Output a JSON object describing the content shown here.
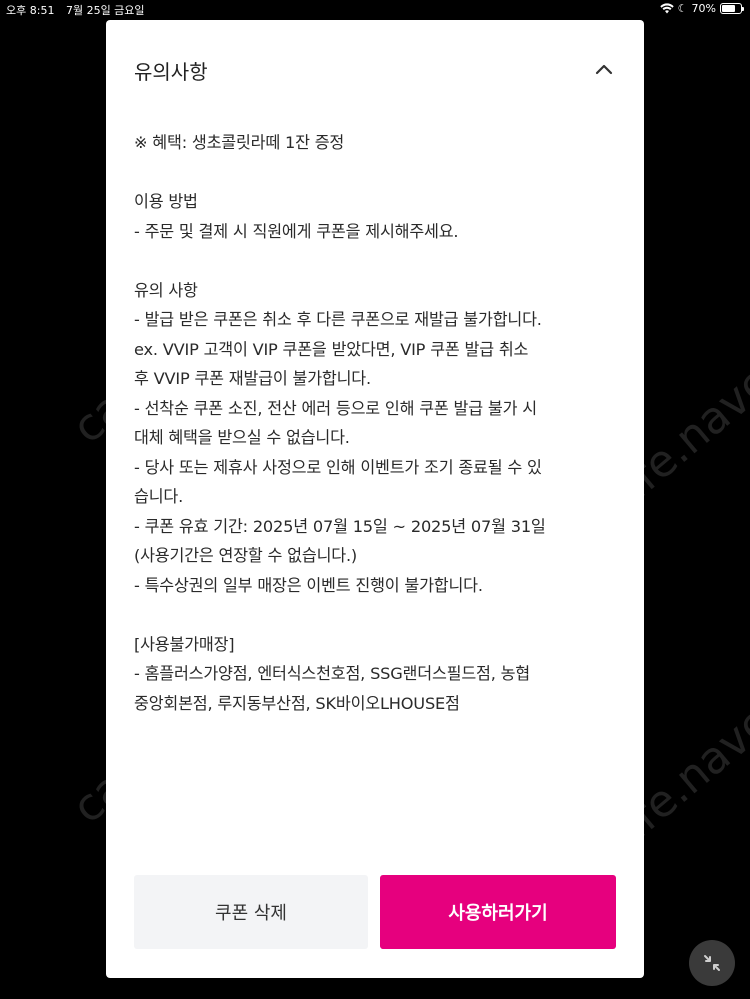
{
  "status_bar": {
    "time": "오후 8:51",
    "date": "7월 25일 금요일",
    "battery": "70%",
    "battery_level": 0.7,
    "icons": [
      "wifi-icon",
      "moon-icon",
      "battery-icon"
    ]
  },
  "watermark": {
    "text": "cafe.naver.com"
  },
  "panel": {
    "title": "유의사항",
    "collapse_icon": "chevron-up-icon",
    "lines": [
      "※ 혜택: 생초콜릿라떼 1잔 증정",
      "",
      "이용 방법",
      "- 주문 및 결제 시 직원에게 쿠폰을 제시해주세요.",
      "",
      "유의 사항",
      "- 발급 받은 쿠폰은 취소 후 다른 쿠폰으로 재발급 불가합니다.",
      "ex. VVIP 고객이 VIP 쿠폰을 받았다면, VIP 쿠폰 발급 취소",
      "후 VVIP 쿠폰 재발급이 불가합니다.",
      "- 선착순 쿠폰 소진, 전산 에러 등으로 인해 쿠폰 발급 불가 시",
      "대체 혜택을 받으실 수 없습니다.",
      "- 당사 또는 제휴사 사정으로 인해 이벤트가 조기 종료될 수 있",
      "습니다.",
      "- 쿠폰 유효 기간: 2025년 07월 15일 ~ 2025년 07월 31일",
      "(사용기간은 연장할 수 없습니다.)",
      "- 특수상권의 일부 매장은 이벤트 진행이 불가합니다.",
      "",
      "[사용불가매장]",
      "- 홈플러스가양점, 엔터식스천호점, SSG랜더스필드점, 농협",
      "중앙회본점, 루지동부산점, SK바이오LHOUSE점"
    ]
  },
  "buttons": {
    "delete_label": "쿠폰 삭제",
    "use_label": "사용하러가기"
  },
  "colors": {
    "accent": "#e6007e",
    "secondary_button": "#f3f4f6",
    "background": "#000000"
  },
  "floating": {
    "icon": "minimize-arrows-icon"
  }
}
